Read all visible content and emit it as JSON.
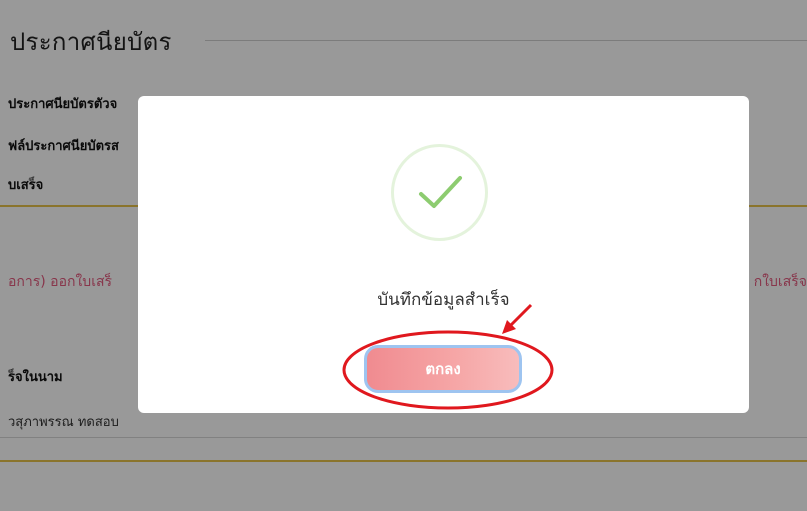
{
  "background": {
    "section_title": "ประกาศนียบัตร",
    "labels": [
      "ประกาศนียบัตรตัวจ",
      "ฟล์ประกาศนียบัตรส",
      "บเสร็จ"
    ],
    "status_left": "อการ) ออกใบเสร็",
    "status_right": "กใบเสร็จ",
    "name_label": "ร็จในนาม",
    "name_value": "วสุภาพรรณ ทดสอบ"
  },
  "modal": {
    "icon": "check-icon",
    "message": "บันทึกข้อมูลสำเร็จ",
    "ok_label": "ตกลง"
  },
  "colors": {
    "overlay": "rgba(0,0,0,0.4)",
    "check": "#8dcc70",
    "button": "#f4a0a2",
    "annotation": "#e0181e"
  }
}
